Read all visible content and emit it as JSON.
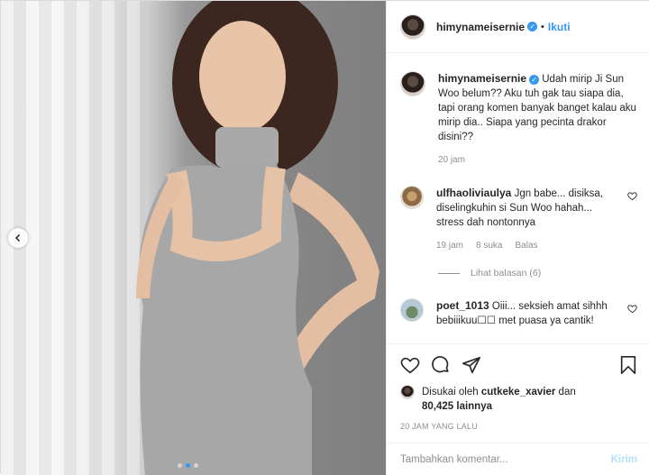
{
  "header": {
    "username": "himynameisernie",
    "verified_mark": "✓",
    "separator": "•",
    "follow_label": "Ikuti"
  },
  "photo": {
    "prev_icon": "chevron-left-icon",
    "slide_count": 3,
    "active_slide": 1
  },
  "caption": {
    "username": "himynameisernie",
    "text": "Udah mirip Ji Sun Woo belum?? Aku tuh gak tau siapa dia, tapi orang komen banyak banget kalau aku mirip dia.. Siapa yang pecinta drakor disini??",
    "time": "20 jam"
  },
  "comments": [
    {
      "username": "ulfhaoliviaulya",
      "text": "Jgn babe... disiksa, diselingkuhin si Sun Woo hahah... stress dah nontonnya",
      "time": "19 jam",
      "likes": "8 suka",
      "reply_label": "Balas",
      "view_replies": "Lihat balasan (6)"
    },
    {
      "username": "poet_1013",
      "text": "Oiii... seksieh amat sihhh bebiiikuu☐☐ met puasa ya cantik!",
      "time": "",
      "likes": "",
      "reply_label": ""
    }
  ],
  "actions": {
    "icons": [
      "heart-icon",
      "comment-icon",
      "share-icon",
      "bookmark-icon"
    ]
  },
  "likes": {
    "prefix": "Disukai oleh",
    "user": "cutkeke_xavier",
    "conjunction": "dan",
    "others": "80,425 lainnya"
  },
  "timestamp": "20 JAM YANG LALU",
  "add_comment": {
    "placeholder": "Tambahkan komentar...",
    "post_label": "Kirim"
  },
  "colors": {
    "accent": "#3897f0",
    "muted": "#8e8e8e",
    "text": "#262626",
    "post_disabled": "#b2dffc"
  }
}
